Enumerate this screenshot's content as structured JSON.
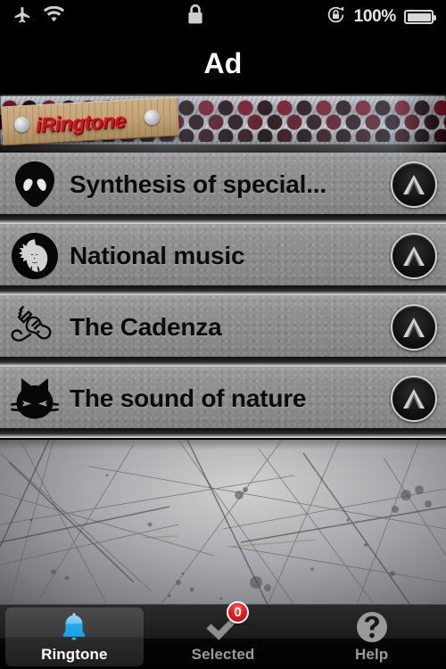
{
  "status_bar": {
    "airplane_icon": "airplane-icon",
    "wifi_icon": "wifi-icon",
    "lock_icon": "lock-icon",
    "rotation_lock_icon": "rotation-lock-icon",
    "battery_percent": "100%",
    "battery_icon": "battery-icon"
  },
  "navbar": {
    "title": "Ad"
  },
  "ad_banner": {
    "logo_text": "iRingtone",
    "name": "iringtone-ad-banner"
  },
  "list": {
    "rows": [
      {
        "label": "Synthesis of special...",
        "icon": "alien-head-icon",
        "action_icon": "chevron-up-circle-icon"
      },
      {
        "label": "National music",
        "icon": "native-chief-head-icon",
        "action_icon": "chevron-up-circle-icon"
      },
      {
        "label": "The Cadenza",
        "icon": "electric-guitar-icon",
        "action_icon": "chevron-up-circle-icon"
      },
      {
        "label": "The sound of nature",
        "icon": "cat-head-icon",
        "action_icon": "chevron-up-circle-icon"
      }
    ]
  },
  "tabbar": {
    "tabs": [
      {
        "label": "Ringtone",
        "icon": "bell-icon",
        "active": true,
        "badge": null
      },
      {
        "label": "Selected",
        "icon": "checkmark-icon",
        "active": false,
        "badge": "0"
      },
      {
        "label": "Help",
        "icon": "question-mark-circle-icon",
        "active": false,
        "badge": null
      }
    ]
  },
  "colors": {
    "accent_blue": "#3fb8f0",
    "badge_red": "#e81c1c",
    "logo_red": "#c8161d",
    "row_gray": "#8e8e8e",
    "tabbar_black": "#000000"
  }
}
